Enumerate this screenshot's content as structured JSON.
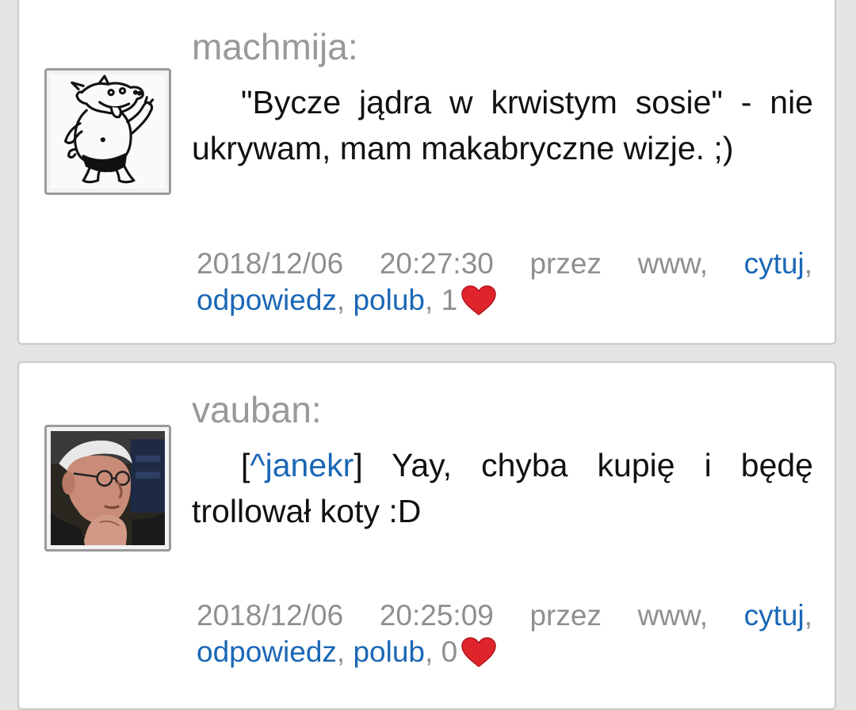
{
  "comments": [
    {
      "author": "machmija:",
      "avatar_icon": "cartoon-pig-avatar",
      "quote_open": "",
      "quote_user": "",
      "quote_close": "",
      "text": "\"Bycze jądra w krwistym sosie\" - nie ukrywam, mam makabryczne wizje. ;)",
      "meta_text": "2018/12/06 20:27:30 przez www,",
      "quote_link": "cytuj",
      "reply_link": "odpowiedz",
      "like_link": "polub",
      "like_count": "1",
      "heart_icon": "heart-icon"
    },
    {
      "author": "vauban:",
      "avatar_icon": "old-man-photo-avatar",
      "quote_open": "[",
      "quote_user": "^janekr",
      "quote_close": "]",
      "text": " Yay, chyba kupię i będę trollował koty :D",
      "meta_text": "2018/12/06 20:25:09 przez www,",
      "quote_link": "cytuj",
      "reply_link": "odpowiedz",
      "like_link": "polub",
      "like_count": "0",
      "heart_icon": "heart-icon"
    }
  ],
  "colors": {
    "background": "#e4e4e4",
    "card": "#ffffff",
    "author": "#999999",
    "link": "#1a67b5",
    "meta": "#8f8f8f",
    "heart": "#e0242c"
  }
}
